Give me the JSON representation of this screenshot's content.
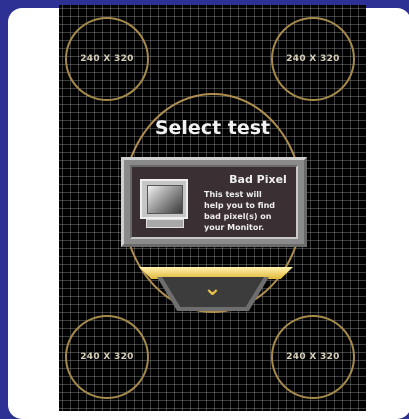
{
  "screen": {
    "corner_labels": [
      "240 X 320",
      "240 X 320",
      "240 X 320",
      "240 X 320"
    ],
    "title": "Select test",
    "panel": {
      "title": "Bad Pixel",
      "lines": [
        "This test will",
        "help you to find",
        "bad pixel(s) on",
        "your Monitor."
      ]
    },
    "nav_icon": "chevron-down-icon",
    "colors": {
      "background": "#2e3194",
      "circle_stroke": "#b08f4e",
      "accent": "#e8c24a"
    }
  }
}
